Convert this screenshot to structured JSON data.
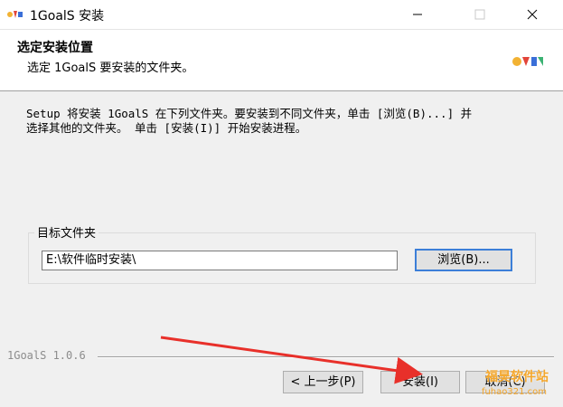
{
  "window": {
    "title": "1GoalS 安装",
    "controls": {
      "minimize": "minimize-icon",
      "maximize": "maximize-icon",
      "close": "close-icon"
    }
  },
  "header": {
    "title": "选定安装位置",
    "subtitle": "选定 1GoalS 要安装的文件夹。"
  },
  "body": {
    "line1": "Setup 将安装 1GoalS 在下列文件夹。要安装到不同文件夹，单击 [浏览(B)...] 并",
    "line2": "选择其他的文件夹。 单击 [安装(I)] 开始安装进程。"
  },
  "destination": {
    "group_label": "目标文件夹",
    "path_value": "E:\\软件临时安装\\",
    "browse_label": "浏览(B)..."
  },
  "footer": {
    "version": "1GoalS 1.0.6",
    "back_label": "< 上一步(P)",
    "install_label": "安装(I)",
    "cancel_label": "取消(C)"
  },
  "watermark": {
    "text": "福昊软件站",
    "url": "fuhao321.com"
  },
  "colors": {
    "arrow": "#e8302a",
    "focus_border": "#3c7fd8",
    "watermark": "#f4a62a"
  }
}
